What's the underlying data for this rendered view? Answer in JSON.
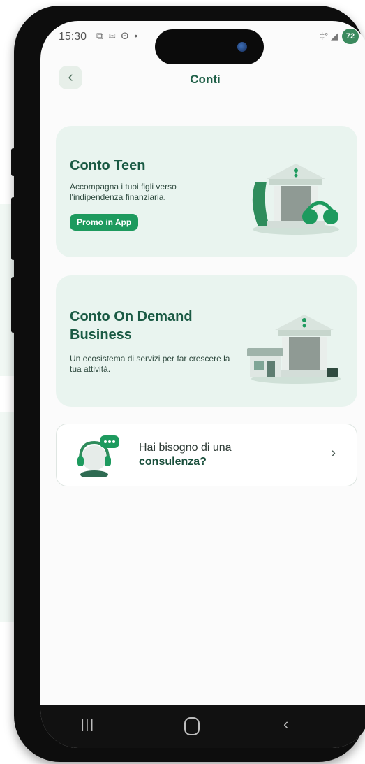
{
  "status_bar": {
    "time": "15:30",
    "left_icons": "⧉ ✉ Θ •",
    "right_icons": "‡° ◢",
    "battery": "72"
  },
  "header": {
    "title": "Conti",
    "back_icon": "‹"
  },
  "cards": [
    {
      "title": "Conto Teen",
      "description": "Accompagna i tuoi figli verso l'indipendenza finanziaria.",
      "button_label": "Promo in App",
      "illustration": "bank-with-headphones-illustration"
    },
    {
      "title": "Conto On Demand Business",
      "description": "Un ecosistema di servizi per far crescere la tua attività.",
      "illustration": "bank-with-shop-illustration"
    }
  ],
  "consult": {
    "line1": "Hai bisogno di una",
    "line2": "consulenza?",
    "chevron": "›",
    "avatar": "support-headset-avatar"
  },
  "nav": {
    "recents": "|||",
    "back": "‹"
  },
  "colors": {
    "accent": "#1d9a5e",
    "title_green": "#1a5a44",
    "card_bg": "#e9f4ef"
  }
}
